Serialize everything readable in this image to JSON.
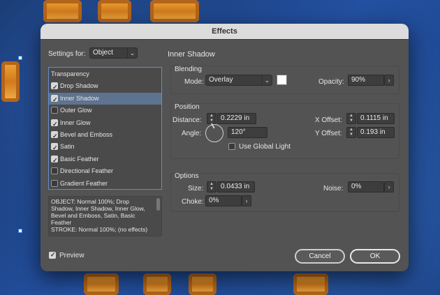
{
  "dialog": {
    "title": "Effects"
  },
  "settings_for": {
    "label": "Settings for:",
    "value": "Object"
  },
  "panel_title": "Inner Shadow",
  "effects": [
    {
      "label": "Transparency",
      "checkbox": false,
      "checked": false
    },
    {
      "label": "Drop Shadow",
      "checkbox": true,
      "checked": true
    },
    {
      "label": "Inner Shadow",
      "checkbox": true,
      "checked": true,
      "selected": true
    },
    {
      "label": "Outer Glow",
      "checkbox": true,
      "checked": false
    },
    {
      "label": "Inner Glow",
      "checkbox": true,
      "checked": true
    },
    {
      "label": "Bevel and Emboss",
      "checkbox": true,
      "checked": true
    },
    {
      "label": "Satin",
      "checkbox": true,
      "checked": true
    },
    {
      "label": "Basic Feather",
      "checkbox": true,
      "checked": true
    },
    {
      "label": "Directional Feather",
      "checkbox": true,
      "checked": false
    },
    {
      "label": "Gradient Feather",
      "checkbox": true,
      "checked": false
    }
  ],
  "summary": "OBJECT: Normal 100%; Drop Shadow, Inner Shadow, Inner Glow, Bevel and Emboss, Satin, Basic Feather\nSTROKE: Normal 100%; (no effects)",
  "blending": {
    "title": "Blending",
    "mode_label": "Mode:",
    "mode_value": "Overlay",
    "swatch_color": "#ffffff",
    "opacity_label": "Opacity:",
    "opacity_value": "90%"
  },
  "position": {
    "title": "Position",
    "distance_label": "Distance:",
    "distance_value": "0.2229 in",
    "angle_label": "Angle:",
    "angle_value": "120°",
    "global_light_label": "Use Global Light",
    "global_light_checked": false,
    "xoffset_label": "X Offset:",
    "xoffset_value": "0.1115 in",
    "yoffset_label": "Y Offset:",
    "yoffset_value": "0.193 in"
  },
  "options": {
    "title": "Options",
    "size_label": "Size:",
    "size_value": "0.0433 in",
    "choke_label": "Choke:",
    "choke_value": "0%",
    "noise_label": "Noise:",
    "noise_value": "0%"
  },
  "preview": {
    "label": "Preview",
    "checked": true
  },
  "buttons": {
    "cancel": "Cancel",
    "ok": "OK"
  },
  "icons": {
    "chevron": "chevron-down-icon",
    "stepper": "stepper-icon",
    "arrow": "chevron-right-icon",
    "angle_dial": "angle-dial-icon"
  },
  "colors": {
    "accent": "#5e8fd4",
    "selected_row": "#5e7390",
    "dialog_bg": "#535353"
  }
}
